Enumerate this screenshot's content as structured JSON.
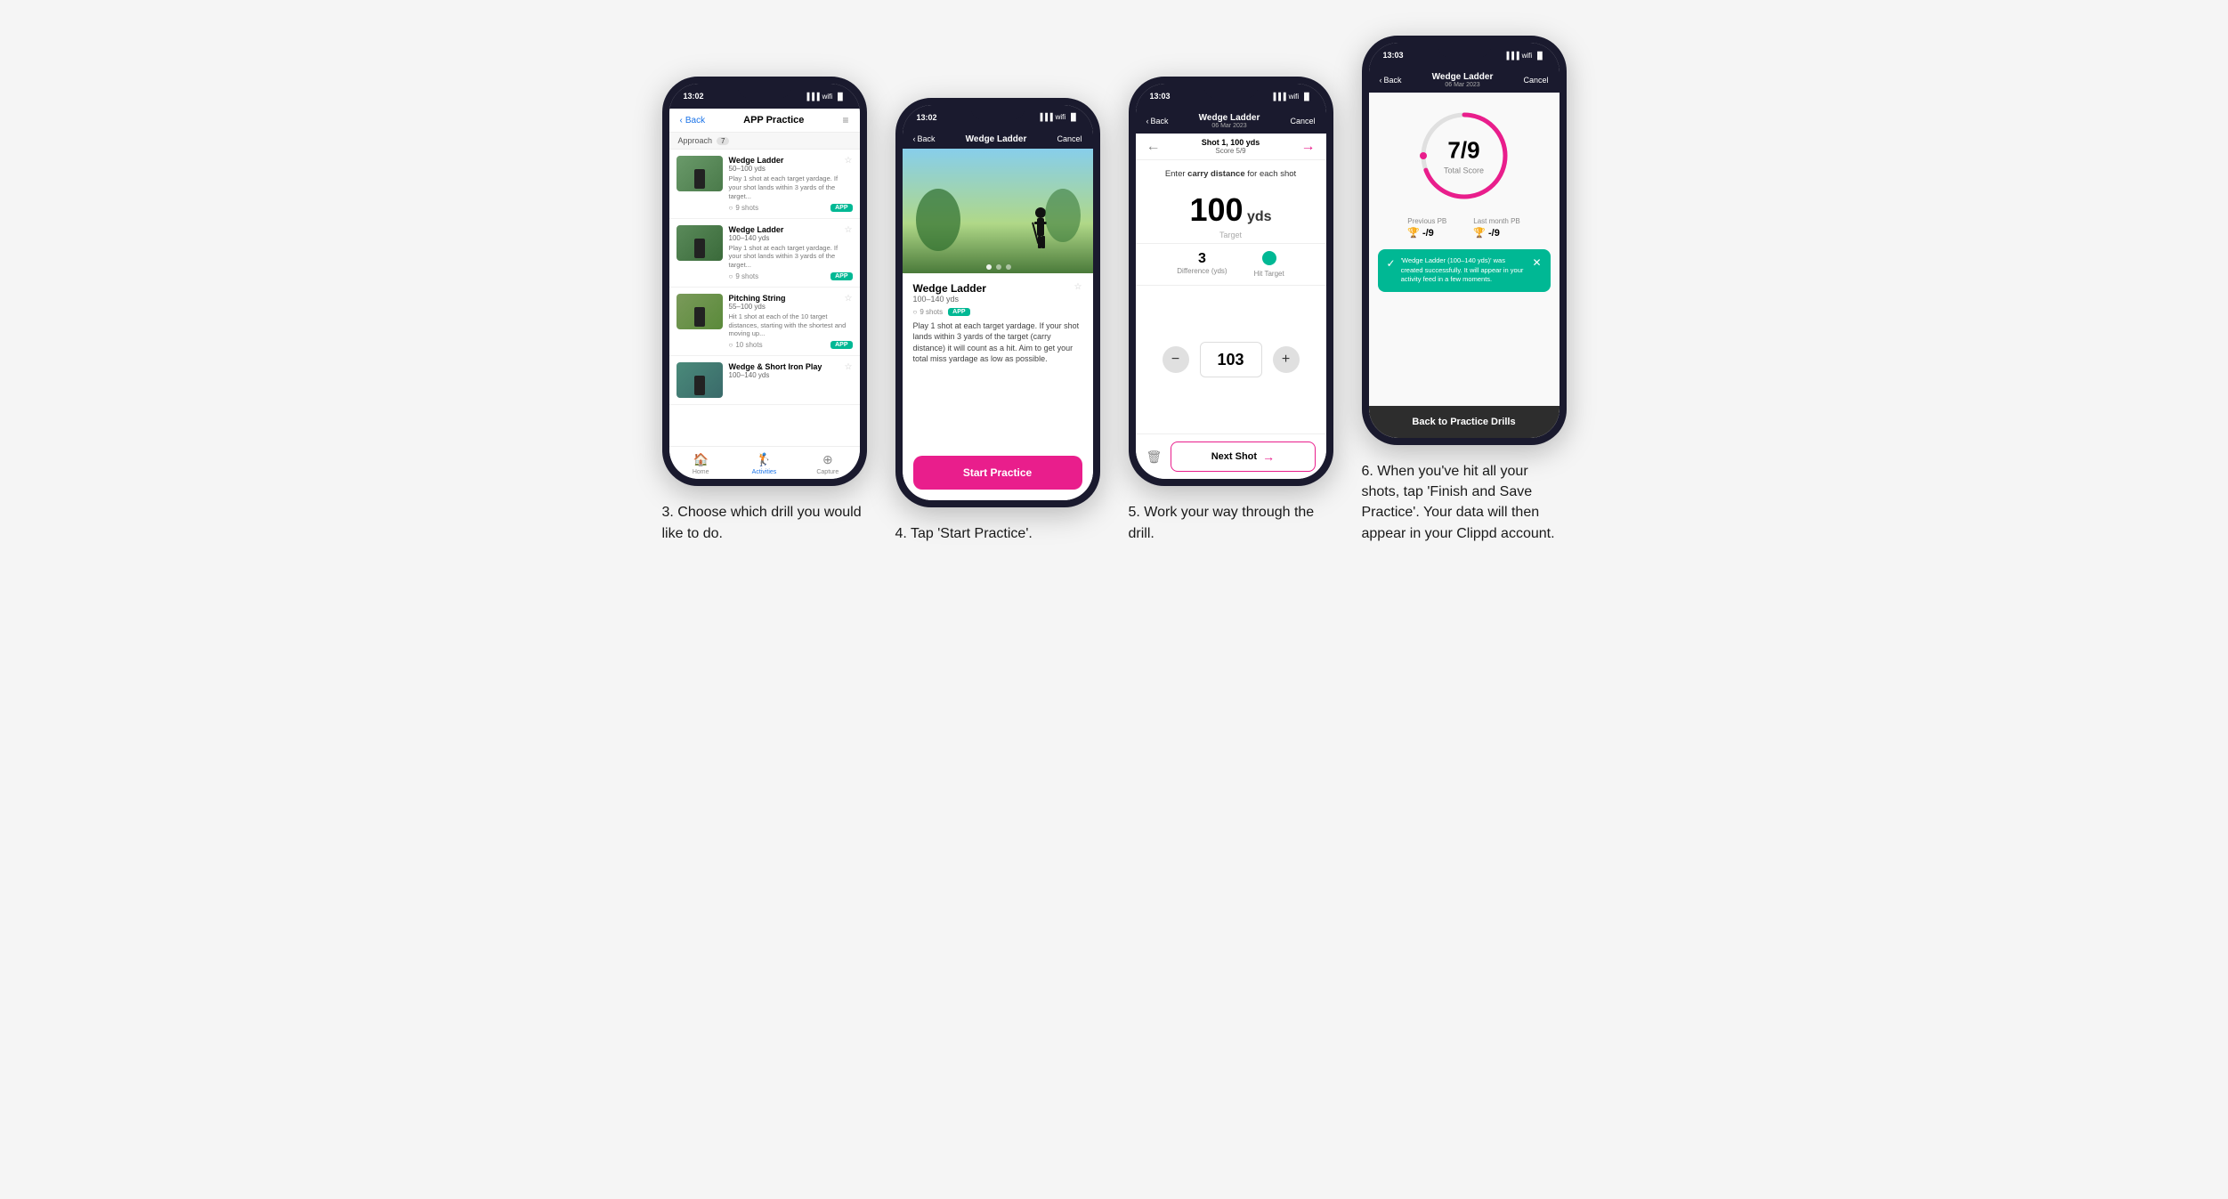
{
  "phones": [
    {
      "id": "phone1",
      "status_time": "13:02",
      "nav_back": "Back",
      "nav_title": "APP Practice",
      "section_label": "Approach",
      "section_count": "7",
      "drills": [
        {
          "name": "Wedge Ladder",
          "range": "50–100 yds",
          "desc": "Play 1 shot at each target yardage. If your shot lands within 3 yards of the target...",
          "shots": "9 shots",
          "badge": "APP"
        },
        {
          "name": "Wedge Ladder",
          "range": "100–140 yds",
          "desc": "Play 1 shot at each target yardage. If your shot lands within 3 yards of the target...",
          "shots": "9 shots",
          "badge": "APP"
        },
        {
          "name": "Pitching String",
          "range": "55–100 yds",
          "desc": "Hit 1 shot at each of the 10 target distances, starting with the shortest and moving up...",
          "shots": "10 shots",
          "badge": "APP"
        },
        {
          "name": "Wedge & Short Iron Play",
          "range": "100–140 yds",
          "desc": "",
          "shots": "",
          "badge": ""
        }
      ],
      "bottom_nav": [
        {
          "icon": "🏠",
          "label": "Home",
          "active": false
        },
        {
          "icon": "🏃",
          "label": "Activities",
          "active": true
        },
        {
          "icon": "➕",
          "label": "Capture",
          "active": false
        }
      ]
    },
    {
      "id": "phone2",
      "status_time": "13:02",
      "nav_back": "Back",
      "nav_title": "Wedge Ladder",
      "nav_cancel": "Cancel",
      "drill_name": "Wedge Ladder",
      "drill_range": "100–140 yds",
      "shots": "9 shots",
      "badge": "APP",
      "description": "Play 1 shot at each target yardage. If your shot lands within 3 yards of the target (carry distance) it will count as a hit. Aim to get your total miss yardage as low as possible.",
      "start_btn": "Start Practice"
    },
    {
      "id": "phone3",
      "status_time": "13:03",
      "nav_back": "Back",
      "nav_title": "Wedge Ladder",
      "nav_subtitle": "06 Mar 2023",
      "nav_cancel": "Cancel",
      "shot_label": "Shot 1, 100 yds",
      "shot_score": "Score 5/9",
      "carry_instruction_pre": "Enter ",
      "carry_instruction_bold": "carry distance",
      "carry_instruction_post": " for each shot",
      "target_yds": "100",
      "target_unit": "yds",
      "target_label": "Target",
      "difference": "3",
      "difference_label": "Difference (yds)",
      "hit_target_label": "Hit Target",
      "input_value": "103",
      "next_shot_label": "Next Shot"
    },
    {
      "id": "phone4",
      "status_time": "13:03",
      "nav_back": "Back",
      "nav_title": "Wedge Ladder",
      "nav_subtitle": "06 Mar 2023",
      "nav_cancel": "Cancel",
      "score_main": "7/9",
      "total_score_label": "Total Score",
      "previous_pb_label": "Previous PB",
      "previous_pb_value": "-/9",
      "last_month_pb_label": "Last month PB",
      "last_month_pb_value": "-/9",
      "success_message": "'Wedge Ladder (100–140 yds)' was created successfully. It will appear in your activity feed in a few moments.",
      "finish_btn": "Back to Practice Drills"
    }
  ],
  "captions": [
    "3. Choose which drill you would like to do.",
    "4. Tap 'Start Practice'.",
    "5. Work your way through the drill.",
    "6. When you've hit all your shots, tap 'Finish and Save Practice'. Your data will then appear in your Clippd account."
  ]
}
